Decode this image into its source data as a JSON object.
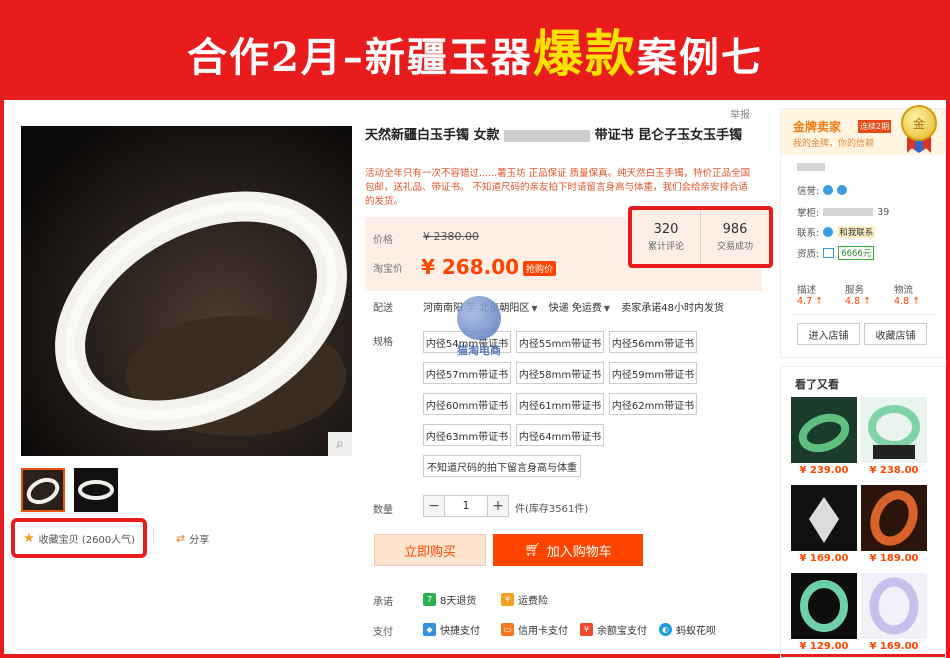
{
  "banner": {
    "prefix": "合作2月–新疆玉器",
    "hot": "爆款",
    "suffix": "案例七"
  },
  "report_label": "举报",
  "product": {
    "title_part1": "天然新疆白玉手镯 女款",
    "title_part2": "带证书 昆仑子玉女玉手镯",
    "subtitle": "活动全年只有一次不容错过......薯玉坊 正品保证 质量保真。纯天然白玉手镯，特价正品全国包邮，送礼品、带证书。 不知道尺码的亲友拍下时请留言身高与体重，我们会给亲安排合适的发货。"
  },
  "pricing": {
    "price_label": "价格",
    "original_price": "¥ 2380.00",
    "tb_price_label": "淘宝价",
    "current_price": "¥ 268.00",
    "promo_tag": "抢购价"
  },
  "stats": [
    {
      "value": "320",
      "label": "累计评论"
    },
    {
      "value": "986",
      "label": "交易成功"
    }
  ],
  "delivery": {
    "label": "配送",
    "origin": "河南南阳 至",
    "destination": "北京朝阳区",
    "shipping": "快递 免运费",
    "promise": "卖家承诺48小时内发货"
  },
  "spec": {
    "label": "规格",
    "options": [
      "内径54mm带证书",
      "内径55mm带证书",
      "内径56mm带证书",
      "内径57mm带证书",
      "内径58mm带证书",
      "内径59mm带证书",
      "内径60mm带证书",
      "内径61mm带证书",
      "内径62mm带证书",
      "内径63mm带证书",
      "内径64mm带证书",
      "不知道尺码的拍下留言身高与体重"
    ]
  },
  "watermark_text": "猫淘电商",
  "quantity": {
    "label": "数量",
    "value": "1",
    "minus": "−",
    "plus": "+",
    "stock": "件(库存3561件)"
  },
  "actions": {
    "buy_now": "立即购买",
    "add_to_cart": "加入购物车"
  },
  "promise": {
    "label": "承诺",
    "items": [
      "8天退货",
      "运费险"
    ]
  },
  "payment": {
    "label": "支付",
    "items": [
      "快捷支付",
      "信用卡支付",
      "余额宝支付",
      "蚂蚁花呗"
    ]
  },
  "favorite": {
    "label": "收藏宝贝 (2600人气)"
  },
  "share": {
    "label": "分享"
  },
  "zoom_icon": "magnifier-icon",
  "seller": {
    "gold_title": "金牌卖家",
    "gold_tag": "连续2期",
    "gold_sub": "我的金牌，你的信赖",
    "medal_text": "金",
    "credit_label": "信誉:",
    "seller_label": "掌柜:",
    "seller_suffix": "39",
    "contact_label": "联系:",
    "contact_btn": "和我联系",
    "qual_label": "资质:",
    "deposit": "6666元",
    "scores": [
      {
        "label": "描述",
        "value": "4.7"
      },
      {
        "label": "服务",
        "value": "4.8"
      },
      {
        "label": "物流",
        "value": "4.8"
      }
    ],
    "enter_shop": "进入店铺",
    "fav_shop": "收藏店铺"
  },
  "recommend": {
    "title": "看了又看",
    "items": [
      {
        "price": "¥ 239.00",
        "color": "#5fbf7f"
      },
      {
        "price": "¥ 238.00",
        "color": "#7fd3a6"
      },
      {
        "price": "¥ 169.00",
        "color": "#dcdcdc"
      },
      {
        "price": "¥ 189.00",
        "color": "#d9622b"
      },
      {
        "price": "¥ 129.00",
        "color": "#6ed0a8"
      },
      {
        "price": "¥ 169.00",
        "color": "#c8c0ec"
      }
    ]
  },
  "colors": {
    "brand_red": "#e81c1c",
    "price_orange": "#ff4400",
    "banner_hot": "#ffe100"
  }
}
